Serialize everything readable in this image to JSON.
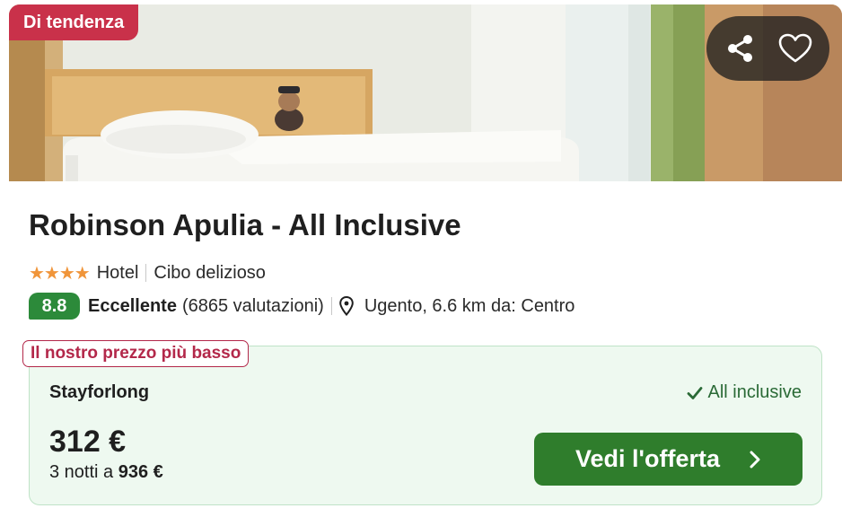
{
  "badge": {
    "label": "Di tendenza",
    "color": "#c9314a"
  },
  "photo_actions": {
    "share_icon": "share-icon",
    "favorite_icon": "heart-icon"
  },
  "hotel": {
    "name": "Robinson Apulia - All Inclusive",
    "stars": 4,
    "type": "Hotel",
    "highlight": "Cibo delizioso",
    "rating": {
      "score": "8.8",
      "label": "Eccellente",
      "reviews": "(6865 valutazioni)",
      "color": "#2c8a3a"
    },
    "location": "Ugento, 6.6 km da: Centro",
    "location_icon": "map-pin-icon"
  },
  "offer": {
    "tag": "Il nostro prezzo più basso",
    "provider": "Stayforlong",
    "amenity": "All inclusive",
    "amenity_icon": "check-icon",
    "price": "312 €",
    "total_prefix": "3 notti a",
    "total": "936 €",
    "cta": "Vedi l'offerta",
    "cta_icon": "chevron-right-icon",
    "cta_color": "#2f7d2c",
    "box_color": "#eef9f0"
  }
}
